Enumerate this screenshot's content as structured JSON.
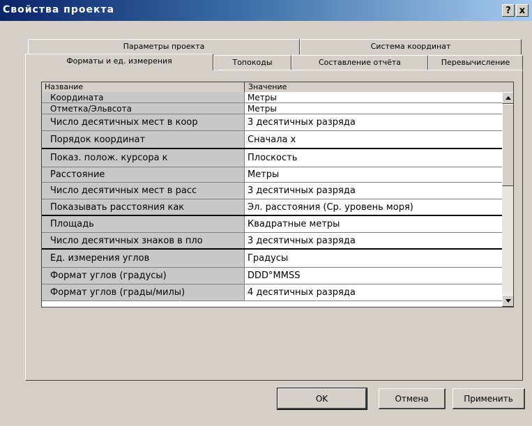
{
  "window": {
    "title": "Свойства проекта",
    "help_label": "?",
    "close_label": "x"
  },
  "tabs_back": [
    {
      "label": "Параметры проекта"
    },
    {
      "label": "Система координат"
    }
  ],
  "tabs_front": [
    {
      "label": "Форматы и ед. измерения",
      "active": true
    },
    {
      "label": "Топокоды"
    },
    {
      "label": "Составление отчёта"
    },
    {
      "label": "Перевычисление"
    }
  ],
  "grid": {
    "header_name": "Название",
    "header_value": "Значение",
    "rows": [
      {
        "name": "Координата",
        "value": "Метры"
      },
      {
        "name": "Отметка/Эльвсота",
        "value": "Метры"
      },
      {
        "name": "Число десятичных мест в коор",
        "value": "3 десятичных разряда"
      },
      {
        "name": "Порядок координат",
        "value": "Сначала x"
      },
      {
        "name": "Показ. полож. курсора к",
        "value": "Плоскость"
      },
      {
        "name": "Расстояние",
        "value": "Метры"
      },
      {
        "name": "Число десятичных мест в расс",
        "value": "3 десятичных разряда"
      },
      {
        "name": "Показывать расстояния как",
        "value": "Эл. расстояния (Ср. уровень моря)"
      },
      {
        "name": "Площадь",
        "value": "Квадратные метры"
      },
      {
        "name": "Число десятичных знаков в пло",
        "value": "3 десятичных разряда"
      },
      {
        "name": "Ед. измерения углов",
        "value": "Градусы"
      },
      {
        "name": "Формат углов (градусы)",
        "value": "DDD°MMSS"
      },
      {
        "name": "Формат углов (грады/милы)",
        "value": "4 десятичных разряда"
      }
    ]
  },
  "buttons": {
    "ok": "OK",
    "cancel": "Отмена",
    "apply": "Применить"
  }
}
